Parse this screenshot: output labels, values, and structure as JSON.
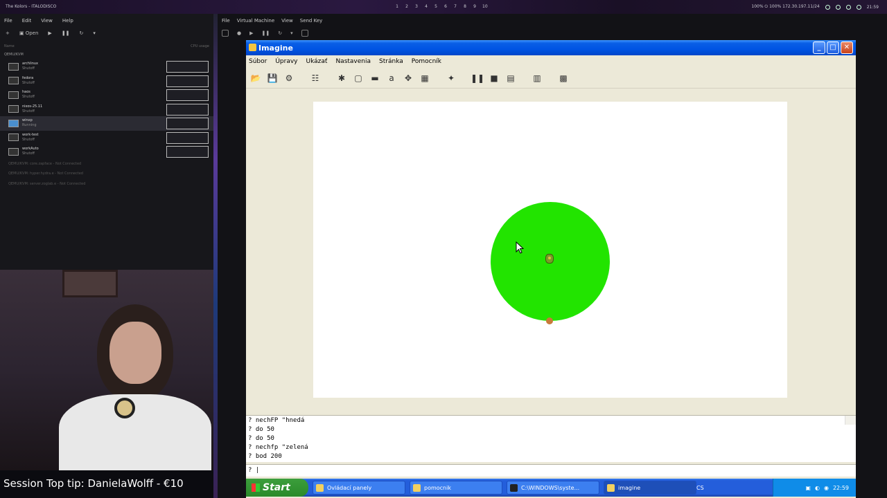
{
  "host_topbar": {
    "app_title": "The Kolors - ITALODISCO",
    "workspaces": [
      "1",
      "2",
      "3",
      "4",
      "5",
      "6",
      "7",
      "8",
      "9",
      "10"
    ],
    "status": "100% ⏻ 100%  172.30.197.11/24",
    "clock": "21:59"
  },
  "vmm": {
    "menu": [
      "File",
      "Edit",
      "View",
      "Help"
    ],
    "open_label": "Open",
    "col_name": "Name",
    "col_cpu": "CPU usage",
    "group": "QEMU/KVM",
    "vms": [
      {
        "name": "archlinux",
        "state": "Shutoff"
      },
      {
        "name": "fedora",
        "state": "Shutoff"
      },
      {
        "name": "haos",
        "state": "Shutoff"
      },
      {
        "name": "nixos-25.11",
        "state": "Shutoff"
      },
      {
        "name": "winxp",
        "state": "Running"
      },
      {
        "name": "work-test",
        "state": "Shutoff"
      },
      {
        "name": "workAuto",
        "state": "Shutoff"
      }
    ],
    "connections": [
      "QEMU/KVM: core.zapface - Not Connected",
      "QEMU/KVM: hyper.hydra.e - Not Connected",
      "QEMU/KVM: server.zoglab.e - Not Connected"
    ]
  },
  "tip": "Session Top tip: DanielaWolff - €10",
  "vm_window": {
    "menu": [
      "File",
      "Virtual Machine",
      "View",
      "Send Key"
    ]
  },
  "imagine": {
    "title": "Imagine",
    "menu": [
      "Súbor",
      "Úpravy",
      "Ukázať",
      "Nastavenia",
      "Stránka",
      "Pomocník"
    ],
    "history": [
      "? nechFP \"hnedá",
      "? do 50",
      "? do 50",
      "? nechfp \"zelená",
      "? bod 200"
    ],
    "prompt": "? |",
    "colors": {
      "fill": "#22e400",
      "dot": "#c87a3a"
    }
  },
  "taskbar": {
    "start": "Start",
    "tasks": [
      "Ovládací panely",
      "pomocnik",
      "C:\\WINDOWS\\syste...",
      "imagine"
    ],
    "lang": "CS",
    "clock": "22:59"
  }
}
